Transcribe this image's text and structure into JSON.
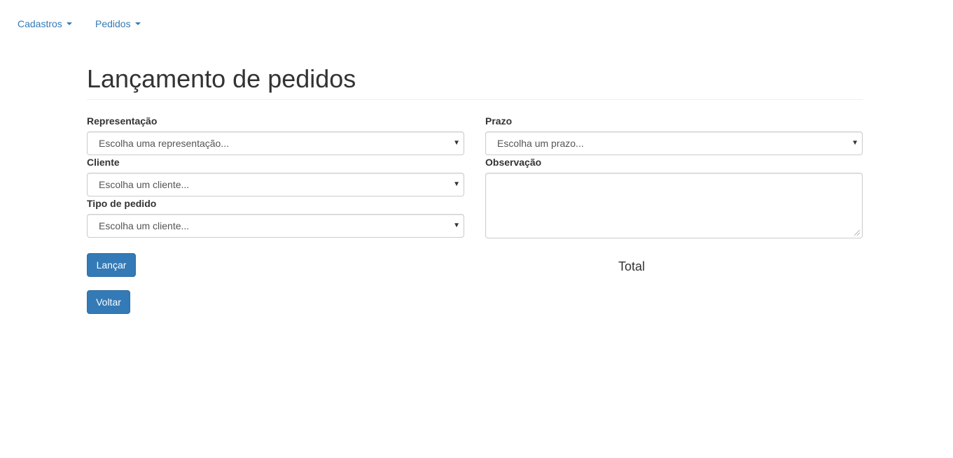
{
  "navbar": {
    "items": [
      {
        "label": "Cadastros"
      },
      {
        "label": "Pedidos"
      }
    ]
  },
  "page": {
    "title": "Lançamento de pedidos"
  },
  "form": {
    "representacao": {
      "label": "Representação",
      "selected": "Escolha uma representação..."
    },
    "cliente": {
      "label": "Cliente",
      "selected": "Escolha um cliente..."
    },
    "tipo_pedido": {
      "label": "Tipo de pedido",
      "selected": "Escolha um cliente..."
    },
    "prazo": {
      "label": "Prazo",
      "selected": "Escolha um prazo..."
    },
    "observacao": {
      "label": "Observação",
      "value": ""
    },
    "total_label": "Total"
  },
  "actions": {
    "lancar_label": "Lançar",
    "voltar_label": "Voltar"
  },
  "icons": {
    "nav_dropdown": "caret-down-icon",
    "select_dropdown": "triangle-down-icon"
  },
  "colors": {
    "link": "#337ab7",
    "primary_button": "#337ab7",
    "primary_button_border": "#2e6da4",
    "text": "#333333"
  }
}
